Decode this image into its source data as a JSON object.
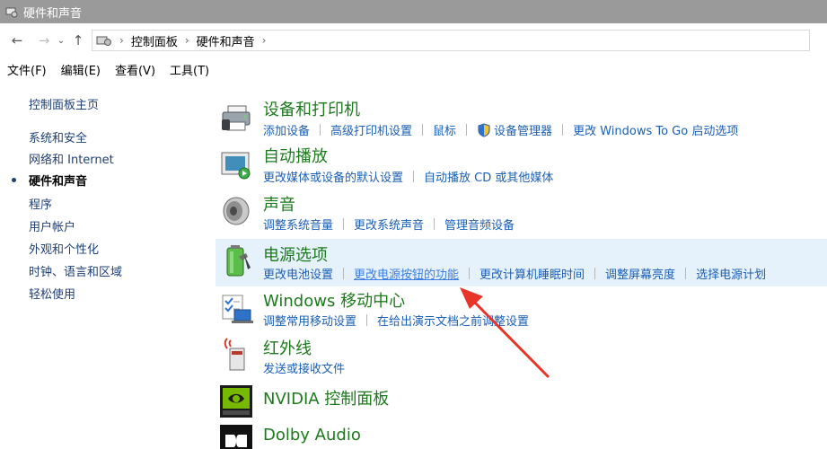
{
  "window": {
    "title": "硬件和声音"
  },
  "nav": {
    "back_icon": "←",
    "forward_icon": "→",
    "dropdown_icon": "⌄",
    "up_icon": "↑",
    "crumbs": [
      "控制面板",
      "硬件和声音"
    ],
    "crumb_sep": "›"
  },
  "menu": [
    "文件(F)",
    "编辑(E)",
    "查看(V)",
    "工具(T)"
  ],
  "sidebar": {
    "items": [
      {
        "label": "控制面板主页"
      },
      {
        "label": "系统和安全"
      },
      {
        "label": "网络和 Internet"
      },
      {
        "label": "硬件和声音"
      },
      {
        "label": "程序"
      },
      {
        "label": "用户帐户"
      },
      {
        "label": "外观和个性化"
      },
      {
        "label": "时钟、语言和区域"
      },
      {
        "label": "轻松使用"
      }
    ],
    "active_index": 3
  },
  "categories": [
    {
      "title": "设备和打印机",
      "icon": "printer-icon",
      "links": [
        "添加设备",
        "高级打印机设置",
        "鼠标",
        "设备管理器",
        "更改 Windows To Go 启动选项"
      ]
    },
    {
      "title": "自动播放",
      "icon": "autoplay-icon",
      "links": [
        "更改媒体或设备的默认设置",
        "自动播放 CD 或其他媒体"
      ]
    },
    {
      "title": "声音",
      "icon": "speaker-icon",
      "links": [
        "调整系统音量",
        "更改系统声音",
        "管理音频设备"
      ]
    },
    {
      "title": "电源选项",
      "icon": "battery-icon",
      "links": [
        "更改电池设置",
        "更改电源按钮的功能",
        "更改计算机睡眠时间",
        "调整屏幕亮度",
        "选择电源计划"
      ]
    },
    {
      "title": "Windows 移动中心",
      "icon": "mobility-center-icon",
      "links": [
        "调整常用移动设置",
        "在给出演示文档之前调整设置"
      ]
    },
    {
      "title": "红外线",
      "icon": "infrared-icon",
      "links": [
        "发送或接收文件"
      ]
    },
    {
      "title": "NVIDIA 控制面板",
      "icon": "nvidia-icon",
      "links": []
    },
    {
      "title": "Dolby Audio",
      "icon": "dolby-icon",
      "links": []
    }
  ],
  "colors": {
    "title_green": "#1c7a1c",
    "link_blue": "#1a5fb4",
    "highlight_row": "#e5f1fb",
    "annotation_arrow": "#e8352a"
  }
}
